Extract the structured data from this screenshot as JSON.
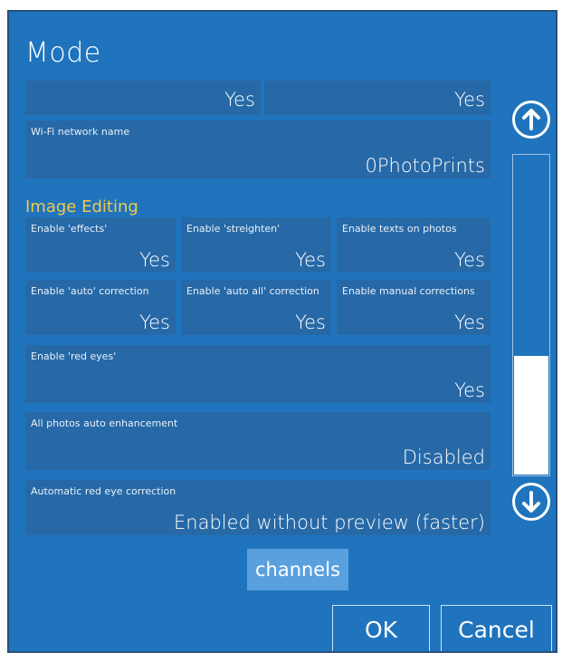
{
  "dialog": {
    "title": "Mode"
  },
  "top_row": {
    "left_value": "Yes",
    "right_value": "Yes"
  },
  "wifi": {
    "label": "Wi-Fi network name",
    "value": "0PhotoPrints"
  },
  "image_editing": {
    "heading": "Image Editing",
    "tiles": [
      {
        "label": "Enable 'effects'",
        "value": "Yes"
      },
      {
        "label": "Enable 'streighten'",
        "value": "Yes"
      },
      {
        "label": "Enable texts on photos",
        "value": "Yes"
      },
      {
        "label": "Enable 'auto' correction",
        "value": "Yes"
      },
      {
        "label": "Enable 'auto all' correction",
        "value": "Yes"
      },
      {
        "label": "Enable manual corrections",
        "value": "Yes"
      }
    ],
    "red_eyes": {
      "label": "Enable 'red eyes'",
      "value": "Yes"
    },
    "auto_enhancement": {
      "label": "All photos auto enhancement",
      "value": "Disabled"
    },
    "auto_red_eye": {
      "label": "Automatic red eye correction",
      "value": "Enabled without preview (faster)"
    }
  },
  "scrollbar": {
    "up_icon": "arrow-up-circle-icon",
    "down_icon": "arrow-down-circle-icon",
    "thumb_position": 0.7
  },
  "channels_button": "channels",
  "buttons": {
    "ok": "OK",
    "cancel": "Cancel"
  },
  "colors": {
    "background": "#1f74bd",
    "tile": "#2769a7",
    "section_heading": "#f2c94c",
    "channels_button": "#5aa0df"
  }
}
